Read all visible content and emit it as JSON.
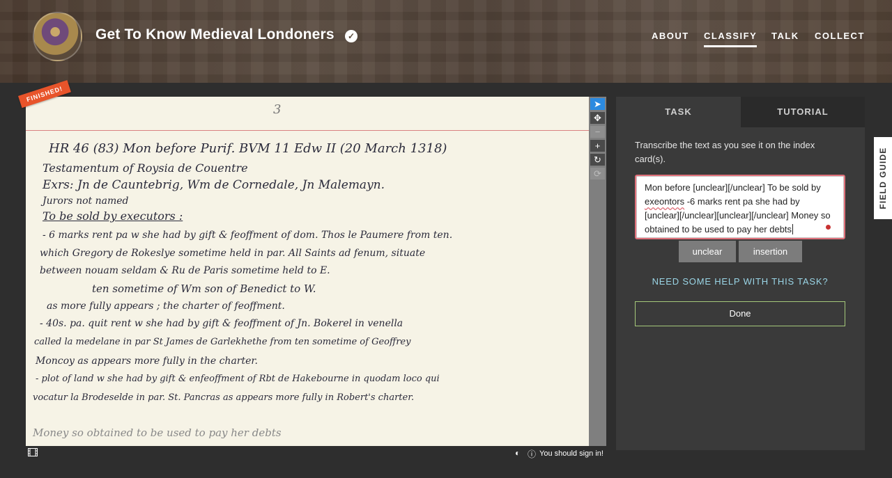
{
  "header": {
    "title": "Get To Know Medieval Londoners",
    "verified_icon": "check-icon",
    "nav": [
      {
        "label": "ABOUT",
        "active": false
      },
      {
        "label": "CLASSIFY",
        "active": true
      },
      {
        "label": "TALK",
        "active": false
      },
      {
        "label": "COLLECT",
        "active": false
      }
    ]
  },
  "subject": {
    "banner": "FINISHED!",
    "card_page_number": "3",
    "card_lines": [
      "HR 46 (83)    Mon before Purif. BVM    11 Edw II    (20 March 1318)",
      "Testamentum of    Roysia de Couentre",
      "Exrs:  Jn de Cauntebrig,  Wm de  Cornedale,  Jn  Malemayn.",
      "Jurors  not  named",
      "To be sold by executors :",
      "- 6 marks rent pa   w she had by gift & feoffment of dom.  Thos le Paumere from ten.",
      "which Gregory  de  Rokeslye sometime held in par.  All Saints ad fenum,  situate",
      "between   nouam seldam   & Ru de Paris   sometime  held  to E.",
      "ten sometime of   Wm son of  Benedict  to  W.",
      "as more fully appears   ; the charter of  feoffment.",
      "- 40s. pa. quit rent   w she had by gift & feoffment of Jn. Bokerel in venella",
      "called  la medelane   in  par  St James de Garlekhethe  from ten sometime of Geoffrey",
      "Moncoy    as   appears   more   fully   in  the   charter.",
      "- plot of land  w she had by gift & enfeoffment of Rbt de Hakebourne  in quodam loco qui",
      "vocatur  la Brodeselde    in  par.  St. Pancras    as  appears  more  fully  in  Robert's charter.",
      "Money   so  obtained   to  be  used  to  pay   her  debts"
    ],
    "tools": [
      {
        "icon": "pointer-icon",
        "glyph": "➤",
        "state": "active"
      },
      {
        "icon": "move-icon",
        "glyph": "✥",
        "state": "normal"
      },
      {
        "icon": "zoom-out-icon",
        "glyph": "−",
        "state": "disabled"
      },
      {
        "icon": "zoom-in-icon",
        "glyph": "+",
        "state": "normal"
      },
      {
        "icon": "rotate-icon",
        "glyph": "↻",
        "state": "normal"
      },
      {
        "icon": "reset-icon",
        "glyph": "⟳",
        "state": "disabled"
      }
    ]
  },
  "footer": {
    "film_icon": "film-icon",
    "contrast_icon": "contrast-icon",
    "info_icon": "info-icon",
    "sign_in_text": "You should sign in!"
  },
  "task_panel": {
    "tabs": {
      "task": "TASK",
      "tutorial": "TUTORIAL"
    },
    "instructions": "Transcribe the text as you see it on the index card(s).",
    "transcription": {
      "part1": "Mon before [unclear][/unclear] To be sold by ",
      "misspelled": "exeontors",
      "part2": " -6 marks rent pa she had by [unclear][/unclear][unclear][/unclear] Money so obtained to be used to pay her debts"
    },
    "buttons": {
      "unclear": "unclear",
      "insertion": "insertion"
    },
    "help_link": "NEED SOME HELP WITH THIS TASK?",
    "done": "Done"
  },
  "field_guide": "FIELD GUIDE"
}
